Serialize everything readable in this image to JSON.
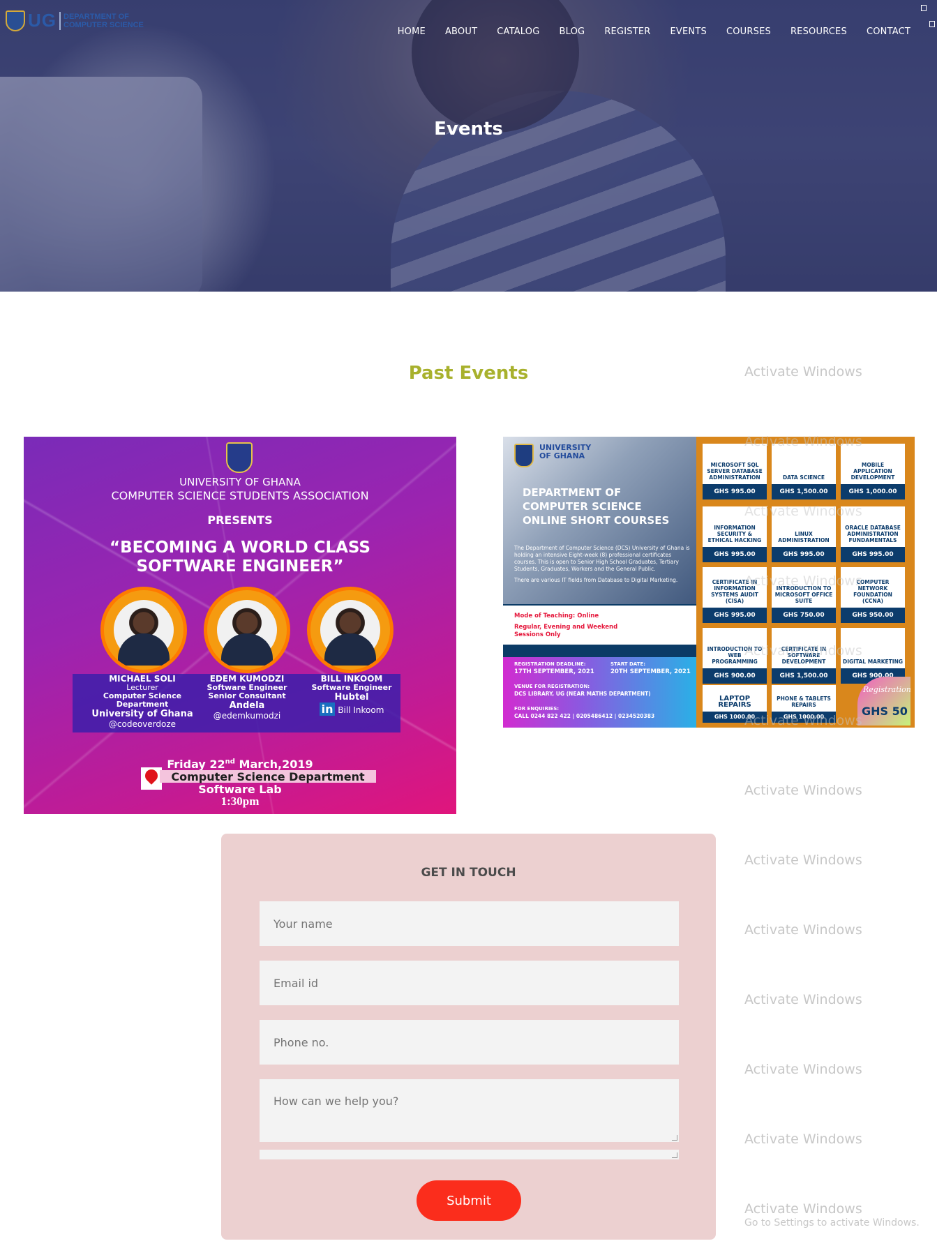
{
  "header": {
    "logo_abbr": "UG",
    "logo_dept_line1": "DEPARTMENT OF",
    "logo_dept_line2": "COMPUTER SCIENCE",
    "nav": [
      "HOME",
      "ABOUT",
      "CATALOG",
      "BLOG",
      "REGISTER",
      "EVENTS",
      "COURSES",
      "RESOURCES",
      "CONTACT"
    ]
  },
  "hero": {
    "title": "Events"
  },
  "past_events": {
    "title": "Past Events",
    "poster1": {
      "university": "UNIVERSITY OF GHANA",
      "association": "COMPUTER SCIENCE STUDENTS ASSOCIATION",
      "presents": "PRESENTS",
      "title_line1": "“BECOMING A WORLD CLASS",
      "title_line2": "SOFTWARE ENGINEER”",
      "speakers": [
        {
          "name": "MICHAEL SOLI",
          "role1": "Lecturer",
          "role2": "Computer Science Department",
          "org": "University of Ghana",
          "handle": "@codeoverdoze"
        },
        {
          "name": "EDEM KUMODZI",
          "role1": "Software Engineer",
          "role2": "Senior Consultant",
          "org": "Andela",
          "handle": "@edemkumodzi"
        },
        {
          "name": "BILL INKOOM",
          "role1": "Software Engineer",
          "role2": "",
          "org": "Hubtel",
          "handle": "Bill Inkoom"
        }
      ],
      "date_prefix": "Friday 22",
      "date_sup": "nd",
      "date_suffix": " March,2019",
      "venue": "Computer Science Department",
      "lab": "Software Lab",
      "time": "1:30pm"
    },
    "poster2": {
      "uni_line1": "UNIVERSITY",
      "uni_line2": "OF GHANA",
      "dept_line1": "DEPARTMENT OF",
      "dept_line2": "COMPUTER SCIENCE",
      "dept_line3": "ONLINE SHORT COURSES",
      "desc": "The Department of Computer Science (DCS) University of Ghana is holding an intensive Eight-week (8) professional certificates courses. This is open to Senior High School Graduates, Tertiary Students, Graduates, Workers and the General Public.",
      "desc2": "There are various IT fields from Database to Digital Marketing.",
      "mode": "Mode of Teaching: Online",
      "sessions_line1": "Regular, Evening and Weekend",
      "sessions_line2": "Sessions Only",
      "reg_deadline_label": "REGISTRATION DEADLINE:",
      "reg_deadline": "17TH SEPTEMBER, 2021",
      "start_label": "START DATE:",
      "start_date": "20TH SEPTEMBER, 2021",
      "venue_label": "VENUE FOR REGISTRATION:",
      "venue": "DCS LIBRARY, UG (NEAR MATHS DEPARTMENT)",
      "enq_label": "FOR ENQUIRIES:",
      "enq": "CALL 0244 822 422 | 0205486412 | 0234520383",
      "courses": [
        {
          "name": "MICROSOFT SQL SERVER DATABASE ADMINISTRATION",
          "price": "GHS 995.00"
        },
        {
          "name": "DATA SCIENCE",
          "price": "GHS 1,500.00"
        },
        {
          "name": "MOBILE APPLICATION DEVELOPMENT",
          "price": "GHS 1,000.00"
        },
        {
          "name": "INFORMATION SECURITY & ETHICAL HACKING",
          "price": "GHS 995.00"
        },
        {
          "name": "LINUX ADMINISTRATION",
          "price": "GHS 995.00"
        },
        {
          "name": "ORACLE DATABASE ADMINISTRATION FUNDAMENTALS",
          "price": "GHS 995.00"
        },
        {
          "name": "CERTIFICATE IN INFORMATION SYSTEMS AUDIT (CISA)",
          "price": "GHS 995.00"
        },
        {
          "name": "INTRODUCTION TO MICROSOFT OFFICE SUITE",
          "price": "GHS 750.00"
        },
        {
          "name": "COMPUTER NETWORK FOUNDATION (CCNA)",
          "price": "GHS 950.00"
        },
        {
          "name": "INTRODUCTION TO WEB PROGRAMMING",
          "price": "GHS 900.00"
        },
        {
          "name": "CERTIFICATE IN SOFTWARE DEVELOPMENT",
          "price": "GHS 1,500.00"
        },
        {
          "name": "DIGITAL MARKETING",
          "price": "GHS 900.00"
        },
        {
          "name": "LAPTOP REPAIRS",
          "price": "GHS 1000.00"
        },
        {
          "name": "PHONE & TABLETS REPAIRS",
          "price": "GHS 1000.00"
        }
      ],
      "reg_fee_label": "Registration",
      "reg_fee": "GHS 50"
    }
  },
  "contact_form": {
    "title": "GET IN TOUCH",
    "name_placeholder": "Your name",
    "email_placeholder": "Email id",
    "phone_placeholder": "Phone no.",
    "message_placeholder": "How can we help you?",
    "submit_label": "Submit"
  },
  "os_watermark": {
    "text": "Activate Windows",
    "subtext": "Go to Settings to activate Windows."
  }
}
